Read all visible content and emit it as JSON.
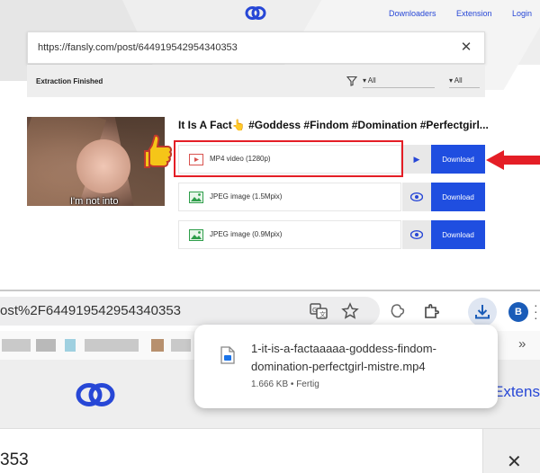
{
  "site": {
    "nav": [
      "Downloaders",
      "Extension",
      "Login"
    ]
  },
  "search": {
    "url": "https://fansly.com/post/644919542954340353"
  },
  "filter": {
    "status": "Extraction Finished",
    "select1": "All",
    "select2": "All"
  },
  "result": {
    "thumbnail_caption": "I'm not into",
    "title": "It Is A Fact👆 #Goddess #Findom #Domination #Perfectgirl...",
    "rows": [
      {
        "label": "MP4 video (1280p)",
        "icon": "video-file-icon",
        "action_icon": "play-icon",
        "button": "Download"
      },
      {
        "label": "JPEG image (1.5Mpix)",
        "icon": "image-file-icon",
        "action_icon": "eye-icon",
        "button": "Download"
      },
      {
        "label": "JPEG image (0.9Mpix)",
        "icon": "image-file-icon",
        "action_icon": "eye-icon",
        "button": "Download"
      }
    ]
  },
  "browser": {
    "address_fragment": "ost%2F644919542954340353",
    "avatar_letter": "B",
    "page_partial_text": "Extensi",
    "url_partial_text": "353"
  },
  "download_popup": {
    "filename": "1-it-is-a-factaaaaa-goddess-findom-domination-perfectgirl-mistre.mp4",
    "meta": "1.666 KB • Fertig"
  },
  "colors": {
    "accent": "#1f4ee0",
    "link": "#2747d6",
    "highlight": "#e41e26"
  }
}
